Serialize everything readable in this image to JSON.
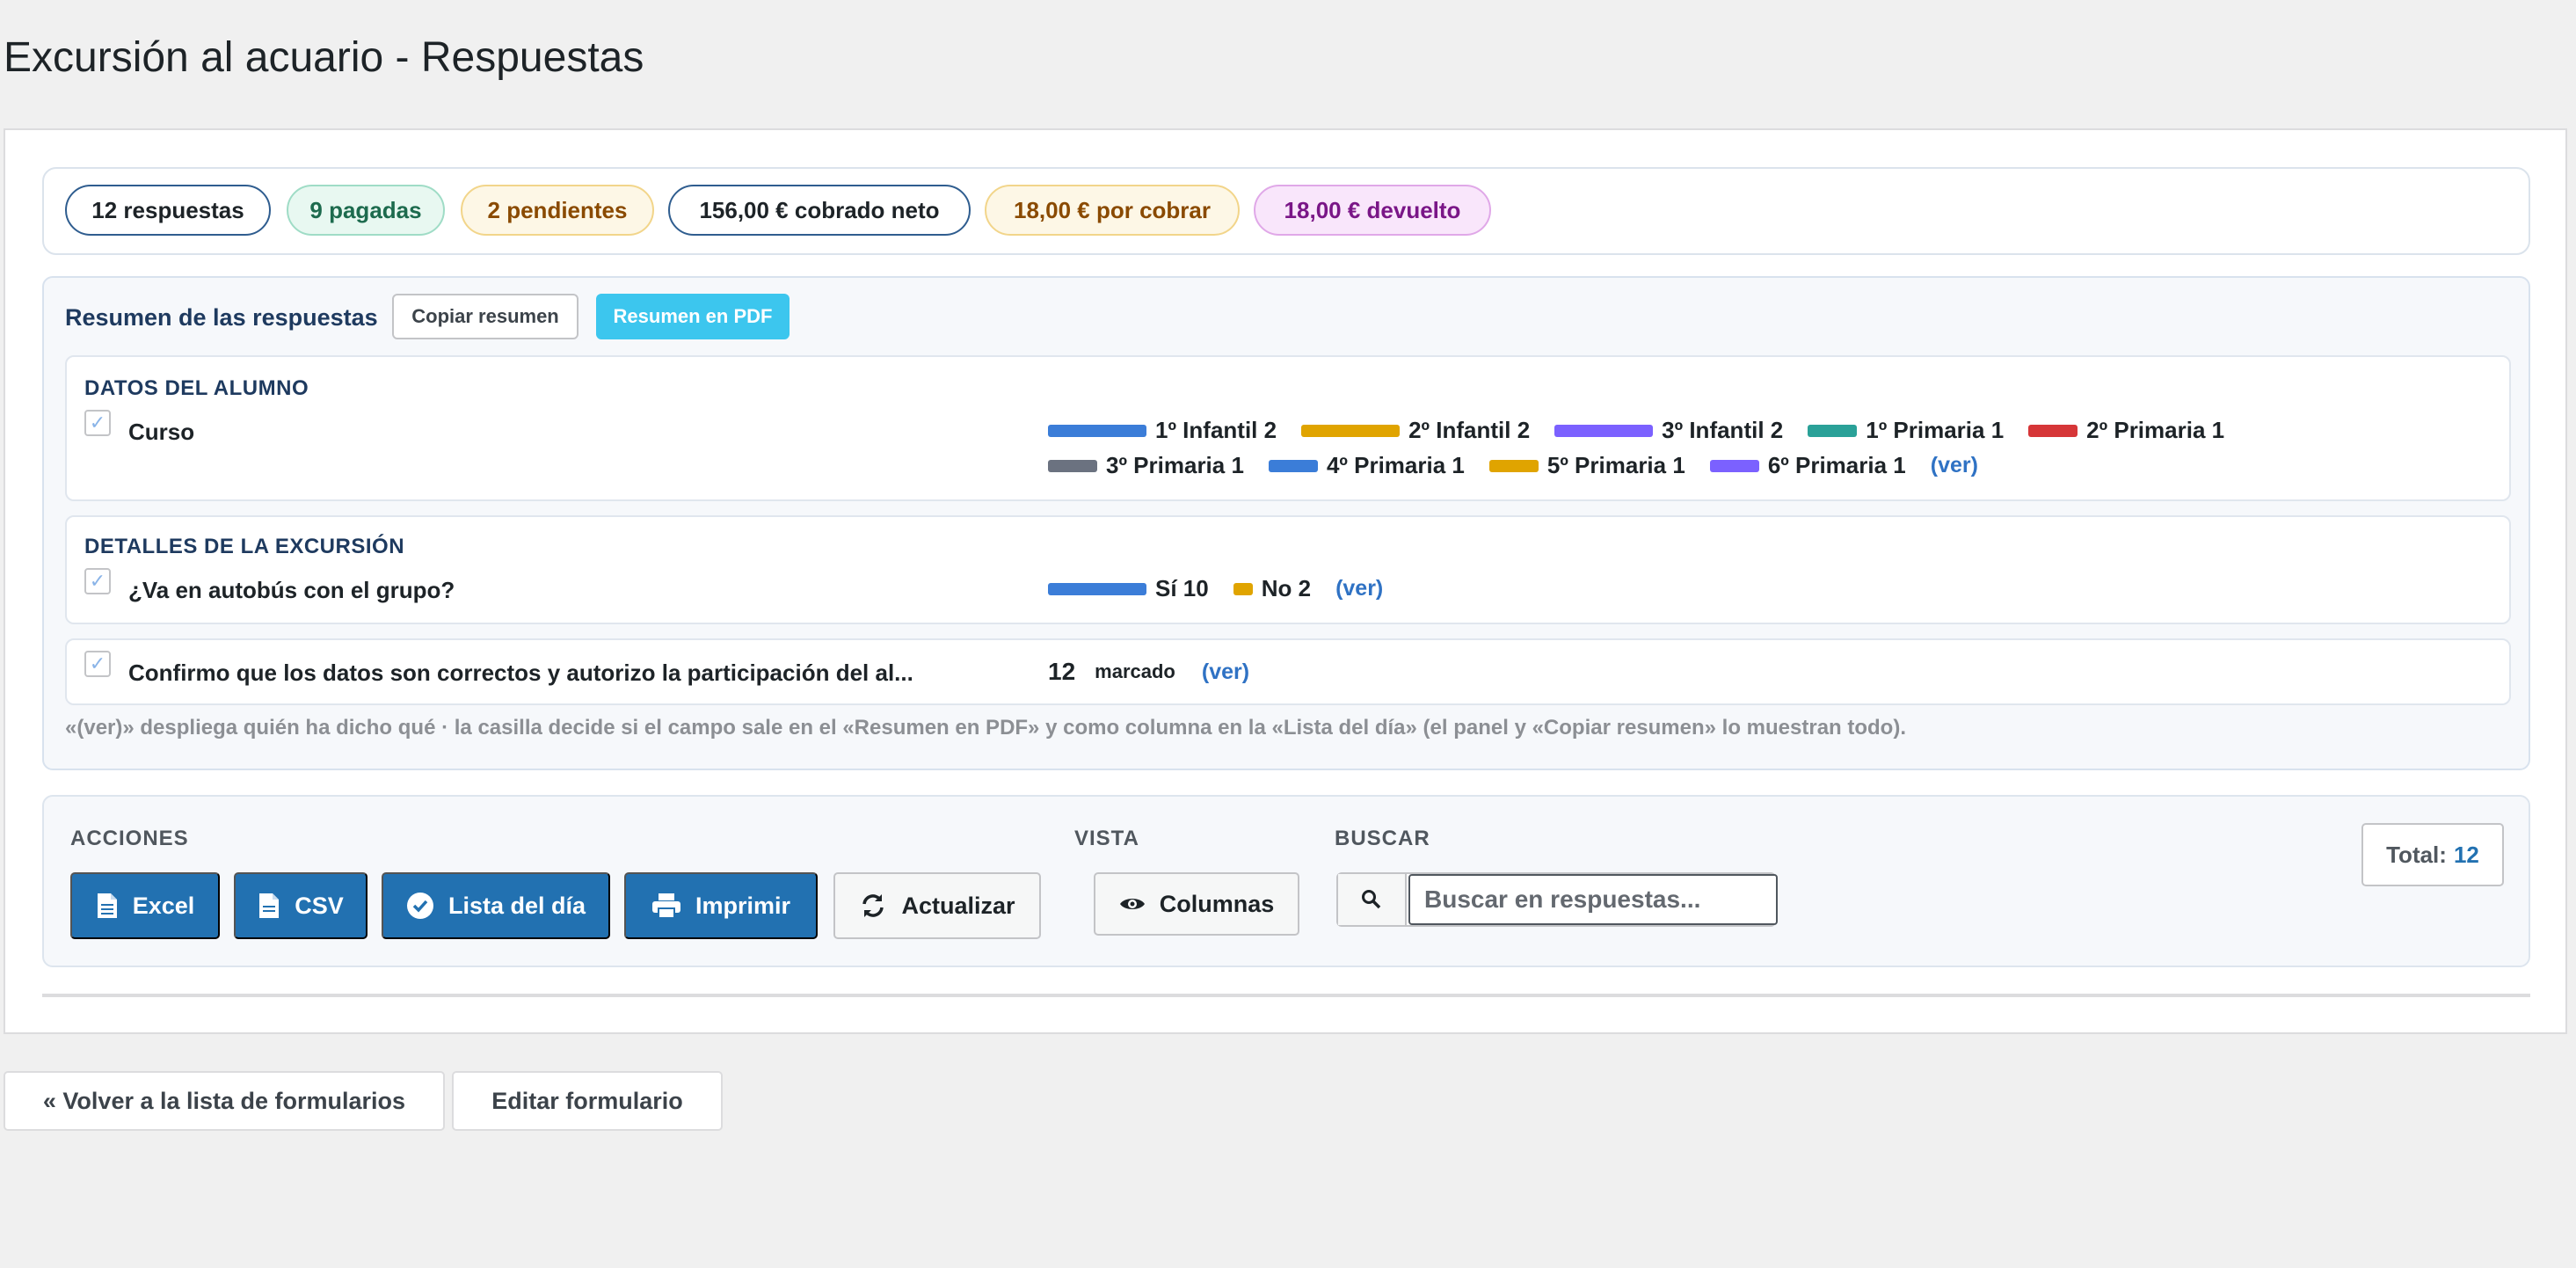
{
  "page": {
    "title": "Excursión al acuario - Respuestas"
  },
  "stats": [
    {
      "label": "12 respuestas",
      "text_color": "#1d2327",
      "border": "#2f5d8f",
      "bg": "#ffffff"
    },
    {
      "label": "9 pagadas",
      "text_color": "#1d6b4e",
      "border": "#9fdcc6",
      "bg": "#e8f8f1"
    },
    {
      "label": "2 pendientes",
      "text_color": "#8a4a00",
      "border": "#f2d58a",
      "bg": "#fdf7e6"
    },
    {
      "label": "156,00 € cobrado neto",
      "text_color": "#1d2327",
      "border": "#2f5d8f",
      "bg": "#ffffff"
    },
    {
      "label": "18,00 € por cobrar",
      "text_color": "#8a4a00",
      "border": "#f2d58a",
      "bg": "#fdf7e6"
    },
    {
      "label": "18,00 € devuelto",
      "text_color": "#7a1687",
      "border": "#e0a8e8",
      "bg": "#f9e6fb"
    }
  ],
  "summary": {
    "title": "Resumen de las respuestas",
    "copy_label": "Copiar resumen",
    "pdf_label": "Resumen en PDF",
    "sections": {
      "alumno": {
        "heading": "DATOS DEL ALUMNO",
        "field": "Curso",
        "checked": true,
        "row1": [
          {
            "label": "1º Infantil 2",
            "color": "#3b7dd8"
          },
          {
            "label": "2º Infantil 2",
            "color": "#e0a400"
          },
          {
            "label": "3º Infantil 2",
            "color": "#7b61ff"
          },
          {
            "label": "1º Primaria 1",
            "color": "#2aa198"
          },
          {
            "label": "2º Primaria 1",
            "color": "#d63638"
          }
        ],
        "row2": [
          {
            "label": "3º Primaria 1",
            "color": "#6b7280"
          },
          {
            "label": "4º Primaria 1",
            "color": "#3b7dd8"
          },
          {
            "label": "5º Primaria 1",
            "color": "#e0a400"
          },
          {
            "label": "6º Primaria 1",
            "color": "#7b61ff"
          }
        ],
        "ver": "(ver)"
      },
      "excursion": {
        "heading": "DETALLES DE LA EXCURSIÓN",
        "field": "¿Va en autobús con el grupo?",
        "checked": true,
        "items": [
          {
            "label": "Sí 10",
            "color": "#3b7dd8",
            "share": 10
          },
          {
            "label": "No 2",
            "color": "#e0a400",
            "share": 2
          }
        ],
        "ver": "(ver)"
      },
      "confirm": {
        "field": "Confirmo que los datos son correctos y autorizo la participación del al...",
        "checked": true,
        "count": "12",
        "count_label": "marcado",
        "ver": "(ver)"
      }
    },
    "note": "«(ver)» despliega quién ha dicho qué · la casilla decide si el campo sale en el «Resumen en PDF» y como columna en la «Lista del día» (el panel y «Copiar resumen» lo muestran todo)."
  },
  "actions": {
    "acciones_label": "ACCIONES",
    "vista_label": "VISTA",
    "buscar_label": "BUSCAR",
    "excel": "Excel",
    "csv": "CSV",
    "lista": "Lista del día",
    "imprimir": "Imprimir",
    "actualizar": "Actualizar",
    "columnas": "Columnas",
    "search_placeholder": "Buscar en respuestas...",
    "total_label": "Total:",
    "total_value": "12",
    "primary_color": "#2271b1"
  },
  "footer": {
    "back": "« Volver a la lista de formularios",
    "edit": "Editar formulario"
  }
}
